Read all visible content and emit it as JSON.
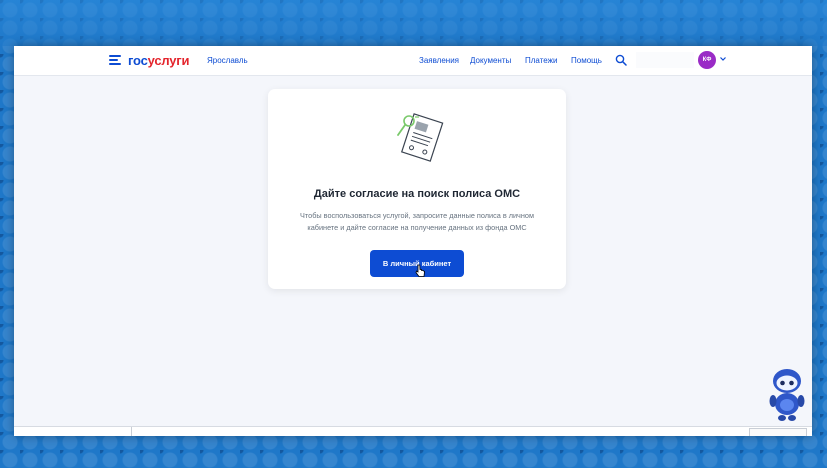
{
  "header": {
    "logo_part1": "гос",
    "logo_part2": "услуги",
    "region": "Ярославль",
    "nav": [
      "Заявления",
      "Документы",
      "Платежи",
      "Помощь"
    ],
    "avatar_initials": "КФ"
  },
  "card": {
    "title": "Дайте согласие на поиск полиса ОМС",
    "text_line1": "Чтобы воспользоваться услугой, запросите данные полиса в личном",
    "text_line2": "кабинете и дайте согласие на получение данных из фонда ОМС",
    "button_label": "В личный кабинет"
  },
  "colors": {
    "brand_blue": "#0d4cd3",
    "brand_red": "#e4252d",
    "avatar_purple": "#9a2bc6",
    "page_bg": "#f4f6fb",
    "outer_bg": "#1f78c9"
  },
  "icons": [
    "menu-icon",
    "search-icon",
    "chevron-down-icon",
    "document-illustration",
    "cursor-icon",
    "robot-assistant-icon"
  ]
}
